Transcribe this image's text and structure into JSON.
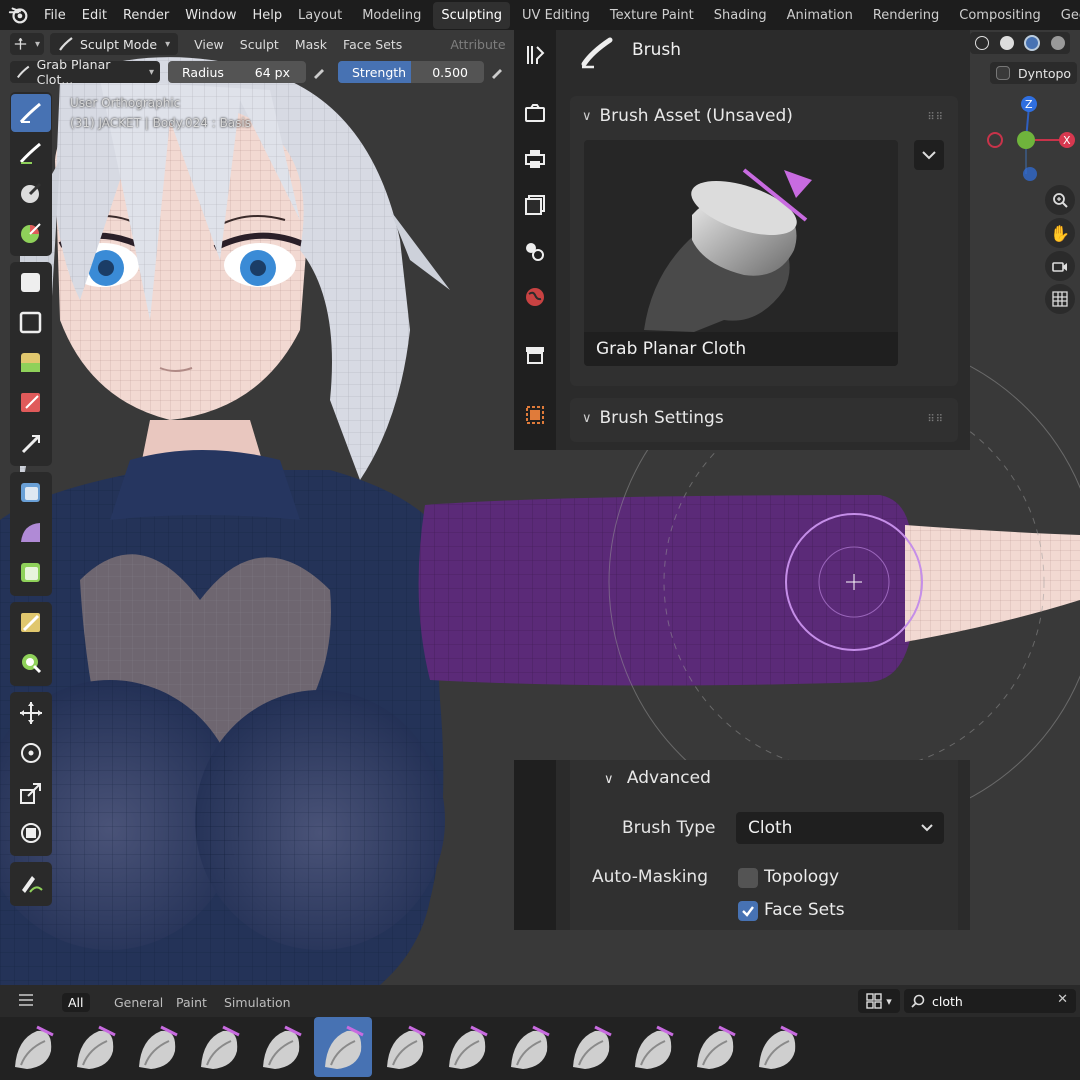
{
  "topbar": {
    "menus": [
      "File",
      "Edit",
      "Render",
      "Window",
      "Help"
    ],
    "workspaces": [
      "Layout",
      "Modeling",
      "Sculpting",
      "UV Editing",
      "Texture Paint",
      "Shading",
      "Animation",
      "Rendering",
      "Compositing",
      "Geometry"
    ],
    "active_workspace": "Sculpting"
  },
  "header": {
    "mode": "Sculpt Mode",
    "menus": [
      "View",
      "Sculpt",
      "Mask",
      "Face Sets"
    ],
    "attribute_label": "Attribute",
    "brush_name": "Grab Planar Clot...",
    "radius_label": "Radius",
    "radius_value": "64 px",
    "strength_label": "Strength",
    "strength_value": "0.500",
    "strength_fraction": 0.5,
    "dyntopo_label": "Dyntopo"
  },
  "viewport": {
    "view_name": "User Orthographic",
    "object_info": "(31) JACKET | Body.024 : Basis",
    "gizmo_axes": [
      "Z",
      "X"
    ]
  },
  "properties": {
    "title": "Brush",
    "brush_asset_header": "Brush Asset (Unsaved)",
    "brush_preview_name": "Grab Planar Cloth",
    "brush_settings_header": "Brush Settings"
  },
  "advanced": {
    "header": "Advanced",
    "brush_type_label": "Brush Type",
    "brush_type_value": "Cloth",
    "automasking_label": "Auto-Masking",
    "topology_label": "Topology",
    "topology_checked": false,
    "face_sets_label": "Face Sets",
    "face_sets_checked": true
  },
  "asset_shelf": {
    "tabs": [
      "All",
      "General",
      "Paint",
      "Simulation"
    ],
    "active_tab": "All",
    "search_value": "cloth",
    "active_asset_index": 5,
    "asset_count": 13
  },
  "colors": {
    "accent_blue": "#4772b3",
    "annotation_blue": "#1e8fe0",
    "sleeve_purple": "#5b2a78",
    "brush_ring": "#c58ee8"
  }
}
